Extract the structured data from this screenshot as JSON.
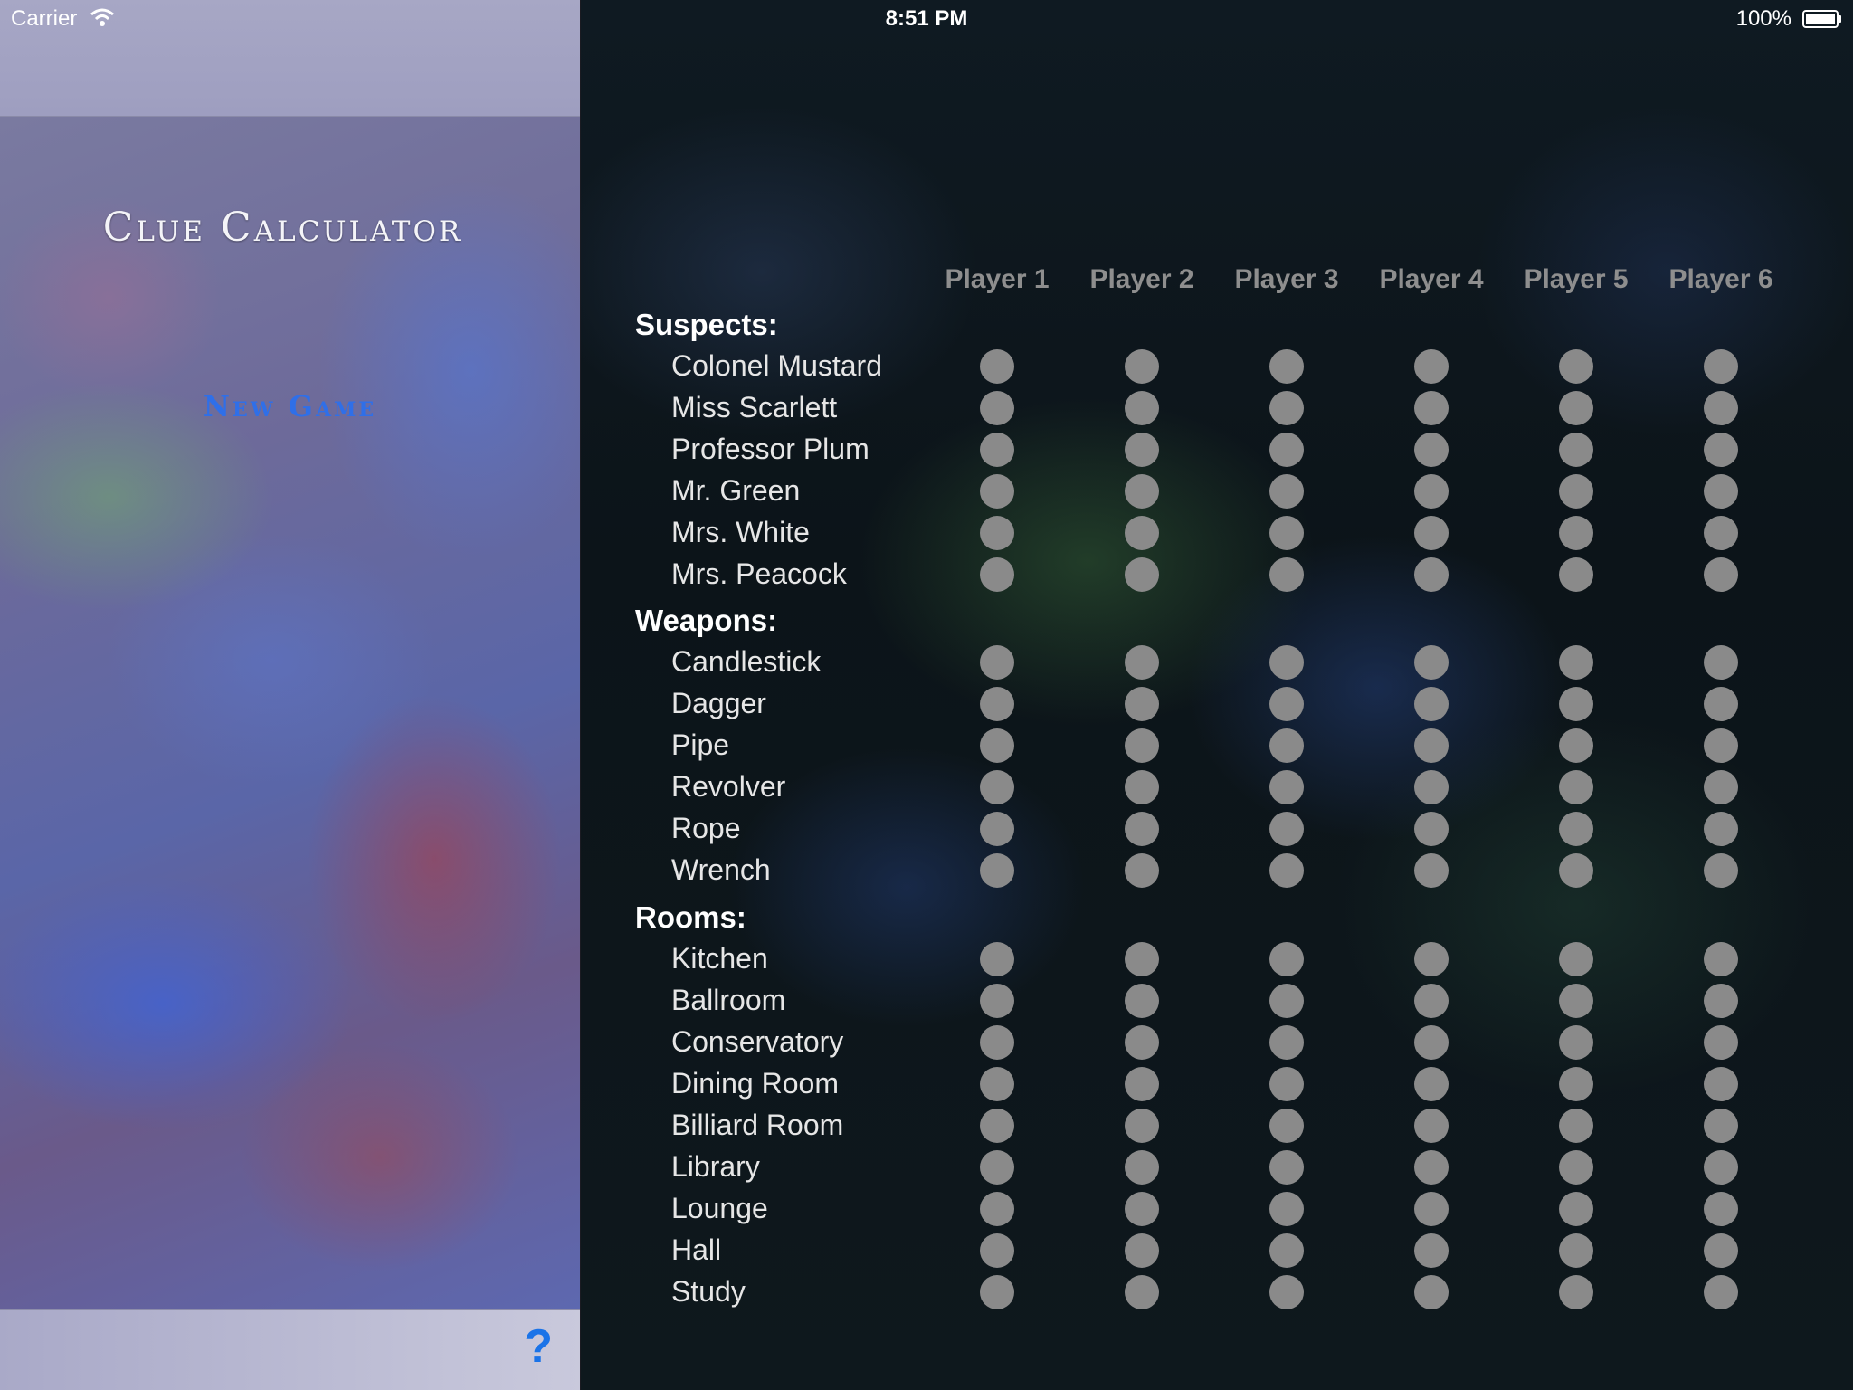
{
  "status_bar": {
    "carrier": "Carrier",
    "time": "8:51 PM",
    "battery": "100%"
  },
  "master": {
    "title": "Clue Calculator",
    "new_game_label": "New Game",
    "help_label": "?"
  },
  "players": [
    "Player 1",
    "Player 2",
    "Player 3",
    "Player 4",
    "Player 5",
    "Player 6"
  ],
  "sections": [
    {
      "title": "Suspects:",
      "items": [
        "Colonel Mustard",
        "Miss Scarlett",
        "Professor Plum",
        "Mr. Green",
        "Mrs. White",
        "Mrs. Peacock"
      ]
    },
    {
      "title": "Weapons:",
      "items": [
        "Candlestick",
        "Dagger",
        "Pipe",
        "Revolver",
        "Rope",
        "Wrench"
      ]
    },
    {
      "title": "Rooms:",
      "items": [
        "Kitchen",
        "Ballroom",
        "Conservatory",
        "Dining Room",
        "Billiard Room",
        "Library",
        "Lounge",
        "Hall",
        "Study"
      ]
    }
  ],
  "colors": {
    "accent": "#2f6fe8",
    "dot": "#8a8a8a",
    "player_header": "#8e8e8e"
  }
}
